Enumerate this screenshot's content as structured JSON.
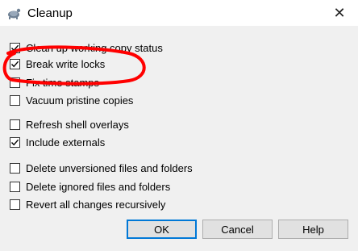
{
  "window": {
    "title": "Cleanup",
    "icon": "tortoise-icon",
    "close_symbol": "✕"
  },
  "options": [
    {
      "label": "Clean up working copy status",
      "checked": true
    },
    {
      "label": "Break write locks",
      "checked": true
    },
    {
      "label": "Fix time stamps",
      "checked": false
    },
    {
      "label": "Vacuum pristine copies",
      "checked": false
    },
    {
      "label": "Refresh shell overlays",
      "checked": false
    },
    {
      "label": "Include externals",
      "checked": true
    },
    {
      "label": "Delete unversioned files and folders",
      "checked": false
    },
    {
      "label": "Delete ignored files and folders",
      "checked": false
    },
    {
      "label": "Revert all changes recursively",
      "checked": false
    }
  ],
  "buttons": {
    "ok": "OK",
    "cancel": "Cancel",
    "help": "Help"
  },
  "annotation": {
    "color": "#ff0000"
  }
}
